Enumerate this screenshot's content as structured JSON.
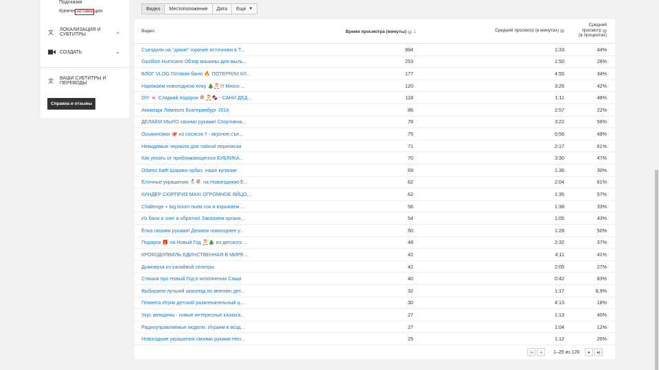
{
  "sidebar": {
    "sub1": "Подсказки",
    "sub2_prefix": "Конечн",
    "sub2_tag": "заставки",
    "sub2_suffix": "ция",
    "localize": "Локализация и субтитры",
    "create": "Создать",
    "your_subs": "Ваши субтитры и переводы",
    "help": "Справка и отзывы"
  },
  "tabs": {
    "video": "Видео",
    "location": "Местоположение",
    "date": "Дата",
    "more": "Еще"
  },
  "table": {
    "headers": {
      "video": "Видео",
      "watch_time": "Время просмотра (минуты)",
      "avg_view": "Средний просмотр (в минутах)",
      "avg_pct_1": "Средний",
      "avg_pct_2": "просмотр",
      "avg_pct_3": "(в процентах)"
    },
    "rows": [
      {
        "title": "Съездили на \"дикие\" горячие источники в Т...",
        "views": "994",
        "avg": "1:33",
        "pct": "44%"
      },
      {
        "title": "Gazillion Hurricane Обзор машины для мыль...",
        "views": "253",
        "avg": "1:50",
        "pct": "26%"
      },
      {
        "title": "ВЛОГ VLOG Готовим баню 🔥 ПОТЕРЯЛИ КЛ...",
        "views": "177",
        "avg": "4:55",
        "pct": "34%"
      },
      {
        "title": "Наряжаем новогоднюю елку 🎄🎅!!! Много ...",
        "views": "120",
        "avg": "3:26",
        "pct": "42%"
      },
      {
        "title": "DIY 🍬 Сладкий подарок 🍭🎅🍫 - САНИ ДЕД...",
        "views": "118",
        "avg": "1:11",
        "pct": "48%"
      },
      {
        "title": "Аквапарк Лимполо Екатеринбург 2016",
        "views": "86",
        "avg": "2:57",
        "pct": "22%"
      },
      {
        "title": "ДЕЛАЕМ МЫЛО своими руками! Спортивна...",
        "views": "78",
        "avg": "3:22",
        "pct": "56%"
      },
      {
        "title": "Осьминожки 🐙 из сосисок ‼ - вкусное съе...",
        "views": "75",
        "avg": "0:56",
        "pct": "49%"
      },
      {
        "title": "Невидимые чернила для тайной переписки",
        "views": "71",
        "avg": "2:17",
        "pct": "61%"
      },
      {
        "title": "Как уехать от приближающегося БУБЛИКА...",
        "views": "70",
        "avg": "3:30",
        "pct": "47%"
      },
      {
        "title": "Orbeez bath Шарики орбиз, наше купание",
        "views": "69",
        "avg": "1:36",
        "pct": "30%"
      },
      {
        "title": "Ёлочные украшения ⛄🍭 на Новогоднюю Ё...",
        "views": "62",
        "avg": "2:04",
        "pct": "61%"
      },
      {
        "title": "КИНДЕР СЮРПРИЗ МАХI ОГРОМНОЕ ЯЙЦО,...",
        "views": "62",
        "avg": "1:35",
        "pct": "57%"
      },
      {
        "title": "Challenge + big boom пьем сок и взрываем ...",
        "views": "56",
        "avg": "1:38",
        "pct": "33%"
      },
      {
        "title": "Из бани в снег и обратно! Закаляем органи...",
        "views": "54",
        "avg": "1:05",
        "pct": "43%"
      },
      {
        "title": "Ёлка своими руками! Делаем новогоднее у...",
        "views": "50",
        "avg": "1:28",
        "pct": "50%"
      },
      {
        "title": "Подарок 🎁 на Новый Год 🎅🎄 из детского ...",
        "views": "48",
        "avg": "2:32",
        "pct": "37%"
      },
      {
        "title": "КРОКОДИЛВИЛЬ ЕДИНСТВЕННАЯ В МИРЕ ...",
        "views": "42",
        "avg": "4:11",
        "pct": "41%"
      },
      {
        "title": "Дымовуха из калийвой селитры",
        "views": "42",
        "avg": "2:05",
        "pct": "27%"
      },
      {
        "title": "Стишок про Новый Год в исполнении Саши",
        "views": "40",
        "avg": "0:42",
        "pct": "83%"
      },
      {
        "title": "Выбираем лучший шоколад по мнению дет...",
        "views": "32",
        "avg": "1:17",
        "pct": "8,9%"
      },
      {
        "title": "Планета Игрик детский развлекательный ц...",
        "views": "30",
        "avg": "4:13",
        "pct": "18%"
      },
      {
        "title": "Укус женщины - новые интересные казахск...",
        "views": "27",
        "avg": "1:13",
        "pct": "40%"
      },
      {
        "title": "Радиоуправляемые модели. Играем в возд...",
        "views": "27",
        "avg": "1:04",
        "pct": "12%"
      },
      {
        "title": "Новогодние украшения своими руками Нео...",
        "views": "25",
        "avg": "1:12",
        "pct": "20%"
      }
    ]
  },
  "pagination": {
    "text": "1–25 из 126",
    "first": "|◂",
    "prev": "◂",
    "next": "▸",
    "last": "▸|"
  },
  "icons": {
    "translate": "translate-icon",
    "camera": "video-camera-icon",
    "subtitles": "subtitles-icon"
  }
}
